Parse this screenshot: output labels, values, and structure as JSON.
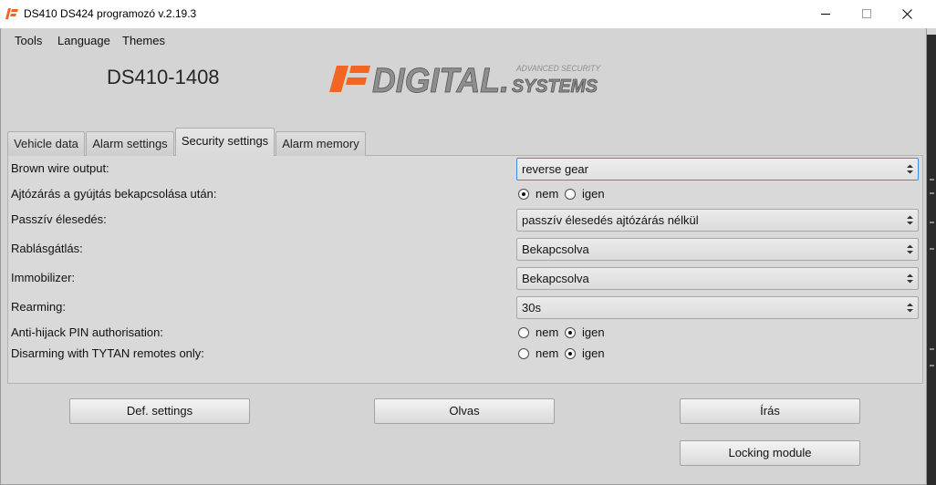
{
  "window": {
    "title": "DS410 DS424 programozó v.2.19.3",
    "icons": {
      "app": "digital-systems-logo-icon",
      "minimize": "minimize-icon",
      "maximize": "maximize-icon",
      "close": "close-icon"
    }
  },
  "menu": {
    "items": [
      {
        "label": "Tools"
      },
      {
        "label": "Language"
      },
      {
        "label": "Themes"
      }
    ]
  },
  "header": {
    "device_name": "DS410-1408",
    "logo": {
      "wordmark": "DIGITAL.",
      "tagline": "ADVANCED SECURITY",
      "subword": "SYSTEMS"
    }
  },
  "tabs": [
    {
      "label": "Vehicle data",
      "active": false
    },
    {
      "label": "Alarm settings",
      "active": false
    },
    {
      "label": "Security settings",
      "active": true
    },
    {
      "label": "Alarm memory",
      "active": false
    }
  ],
  "security_settings": {
    "rows": [
      {
        "label": "Brown wire output:",
        "value": "reverse gear",
        "focused": true
      },
      {
        "label": "Ajtózárás a gyújtás bekapcsolása után:",
        "options": [
          "nem",
          "igen"
        ],
        "selected_index": 0
      },
      {
        "label": "Passzív élesedés:",
        "value": "passzív élesedés ajtózárás nélkül",
        "focused": false
      },
      {
        "label": "Rablásgátlás:",
        "value": "Bekapcsolva",
        "focused": false
      },
      {
        "label": "Immobilizer:",
        "value": "Bekapcsolva",
        "focused": false
      },
      {
        "label": "Rearming:",
        "value": "30s",
        "focused": false
      },
      {
        "label": "Anti-hijack PIN authorisation:",
        "options": [
          "nem",
          "igen"
        ],
        "selected_index": 1
      },
      {
        "label": "Disarming with TYTAN remotes only:",
        "options": [
          "nem",
          "igen"
        ],
        "selected_index": 1
      }
    ]
  },
  "buttons": {
    "default_settings": "Def. settings",
    "read": "Olvas",
    "write": "Írás",
    "locking_module": "Locking module"
  },
  "icons": {
    "select_arrow": "up-down-arrows-icon",
    "radio": "radio-button"
  },
  "colors": {
    "accent": "#f26522",
    "logo_gray": "#8e8e8e",
    "focus_border": "#3c8ee0",
    "window_bg": "#d4d4d4",
    "background_window": "#2b2b2b"
  }
}
